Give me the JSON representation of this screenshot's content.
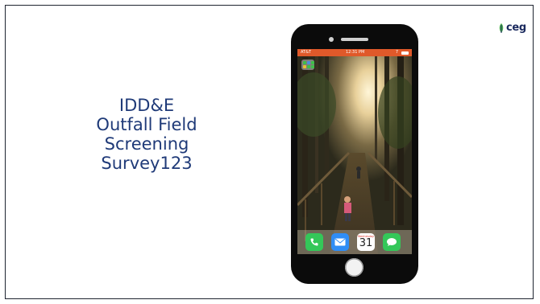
{
  "slide": {
    "title_lines": [
      "IDD&E",
      "Outfall Field",
      "Screening",
      "Survey123"
    ]
  },
  "logo": {
    "text": "ceg"
  },
  "phone": {
    "status_bar": {
      "carrier": "AT&T",
      "time": "12:31 PM",
      "signal": "7"
    },
    "dock": {
      "apps": [
        {
          "name": "Phone",
          "icon": "phone-icon"
        },
        {
          "name": "Mail",
          "icon": "mail-icon"
        },
        {
          "name": "Calendar",
          "icon": "calendar-icon",
          "day": "Wednesday",
          "date": "31"
        },
        {
          "name": "Messages",
          "icon": "messages-icon"
        }
      ]
    }
  },
  "colors": {
    "title": "#1f3a78",
    "status_bar": "#e0592a",
    "logo_text": "#1b2a5e"
  }
}
